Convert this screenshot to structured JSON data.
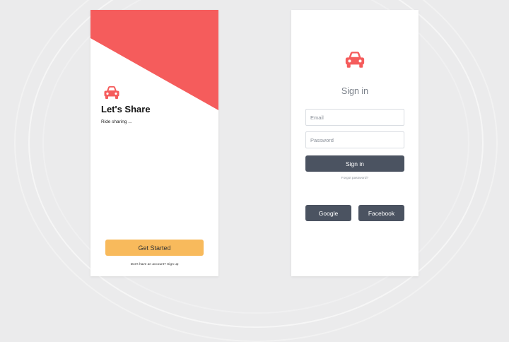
{
  "colors": {
    "background": "#ebebec",
    "accent_red": "#f55c5c",
    "button_yellow": "#f8ba5c",
    "button_dark": "#4b5361"
  },
  "welcome_screen": {
    "logo_icon": "car-icon",
    "title": "Let's Share",
    "subtitle": "Ride sharing ...",
    "get_started_label": "Get Started",
    "signup_prompt": "Don't have an account? Sign up"
  },
  "signin_screen": {
    "logo_icon": "car-icon",
    "title": "Sign in",
    "email_placeholder": "Email",
    "password_placeholder": "Password",
    "signin_label": "Sign in",
    "forgot_password": "Forgot password?",
    "google_label": "Google",
    "facebook_label": "Facebook"
  }
}
